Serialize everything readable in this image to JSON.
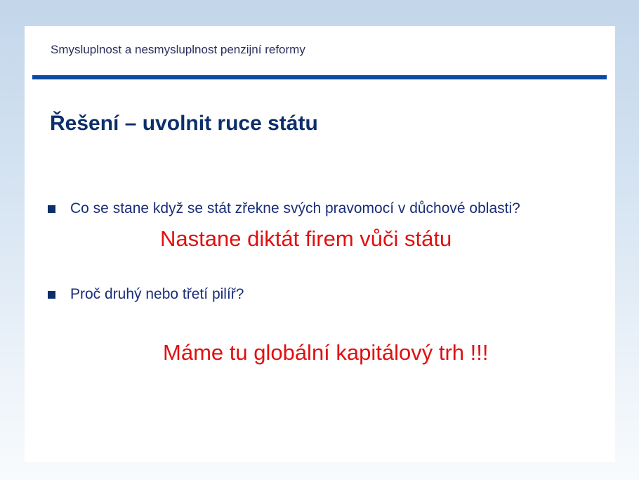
{
  "header": {
    "title": "Smysluplnost a nesmysluplnost penzijní reformy"
  },
  "slide": {
    "heading": "Řešení – uvolnit ruce státu",
    "bullets": [
      {
        "text": "Co se stane když se stát zřekne svých pravomocí v důchové oblasti?"
      },
      {
        "text": "Proč druhý nebo třetí pilíř?"
      }
    ],
    "answers": [
      {
        "text": "Nastane diktát firem vůči státu"
      },
      {
        "text": "Máme tu globální kapitálový trh !!!"
      }
    ]
  },
  "colors": {
    "heading": "#0c2f6b",
    "bullet_text": "#1a2d78",
    "rule": "#0a4aa0",
    "answer": "#e01010"
  }
}
